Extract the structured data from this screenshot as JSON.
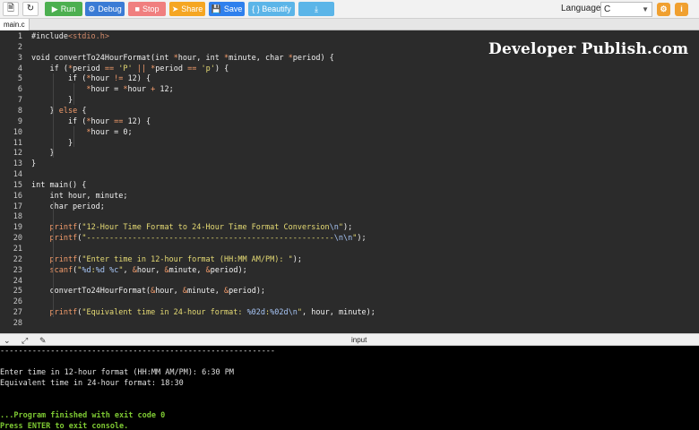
{
  "toolbar": {
    "run_label": "Run",
    "debug_label": "Debug",
    "stop_label": "Stop",
    "share_label": "Share",
    "save_label": "Save",
    "beautify_label": "{ } Beautify",
    "language_label": "Language",
    "language_value": "C",
    "colors": {
      "run": "#4caf50",
      "debug": "#3a7bd5",
      "stop": "#f07f7f",
      "share": "#f5a623",
      "save": "#2f80ed",
      "beautify": "#5bb5e8",
      "download": "#5bb5e8"
    }
  },
  "tabs": [
    {
      "label": "main.c"
    }
  ],
  "watermark": "Developer Publish.com",
  "editor": {
    "line_numbers": [
      "1",
      "2",
      "3",
      "4",
      "5",
      "6",
      "7",
      "8",
      "9",
      "10",
      "11",
      "12",
      "13",
      "14",
      "15",
      "16",
      "17",
      "18",
      "19",
      "20",
      "21",
      "22",
      "23",
      "24",
      "25",
      "26",
      "27",
      "28"
    ],
    "lines": [
      "#include<stdio.h>",
      "",
      "void convertTo24HourFormat(int *hour, int *minute, char *period) {",
      "    if (*period == 'P' || *period == 'p') {",
      "        if (*hour != 12) {",
      "            *hour = *hour + 12;",
      "        }",
      "    } else {",
      "        if (*hour == 12) {",
      "            *hour = 0;",
      "        }",
      "    }",
      "}",
      "",
      "int main() {",
      "    int hour, minute;",
      "    char period;",
      "",
      "    printf(\"12-Hour Time Format to 24-Hour Time Format Conversion\\n\");",
      "    printf(\"------------------------------------------------------\\n\\n\");",
      "",
      "    printf(\"Enter time in 12-hour format (HH:MM AM/PM): \");",
      "    scanf(\"%d:%d %c\", &hour, &minute, &period);",
      "",
      "    convertTo24HourFormat(&hour, &minute, &period);",
      "",
      "    printf(\"Equivalent time in 24-hour format: %02d:%02d\\n\", hour, minute);",
      ""
    ]
  },
  "divider": {
    "label": "input"
  },
  "console": {
    "lines": [
      "------------------------------------------------------------",
      "",
      "Enter time in 12-hour format (HH:MM AM/PM): 6:30 PM",
      "Equivalent time in 24-hour format: 18:30",
      "",
      "",
      "...Program finished with exit code 0",
      "Press ENTER to exit console."
    ]
  }
}
